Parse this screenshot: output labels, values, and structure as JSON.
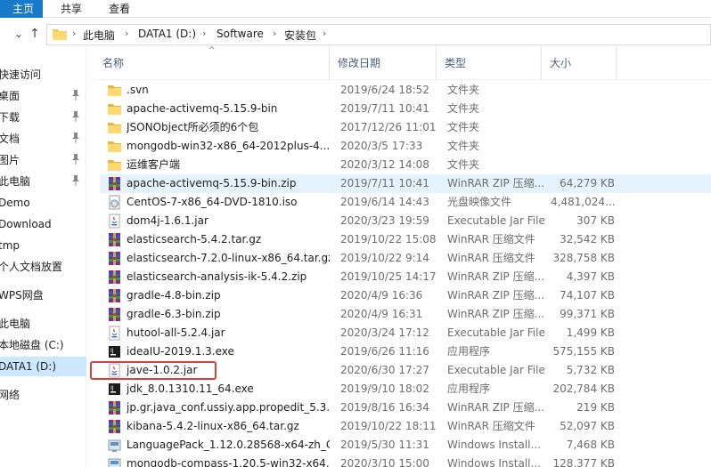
{
  "ribbon": {
    "tabs": [
      {
        "label": "主页"
      },
      {
        "label": "共享"
      },
      {
        "label": "查看"
      }
    ]
  },
  "address": {
    "crumbs": [
      "此电脑",
      "DATA1 (D:)",
      "Software",
      "安装包"
    ]
  },
  "nav": {
    "items": [
      {
        "label": "快速访问",
        "pinned": false
      },
      {
        "label": "桌面",
        "pinned": true
      },
      {
        "label": "下载",
        "pinned": true
      },
      {
        "label": "文档",
        "pinned": true
      },
      {
        "label": "图片",
        "pinned": true
      },
      {
        "label": "此电脑",
        "pinned": true
      },
      {
        "label": "Demo",
        "pinned": false
      },
      {
        "label": "Download",
        "pinned": false
      },
      {
        "label": "tmp",
        "pinned": false
      },
      {
        "label": "个人文档放置",
        "pinned": false
      },
      {
        "label": "WPS网盘",
        "pinned": false
      },
      {
        "label": "此电脑",
        "pinned": false
      },
      {
        "label": "本地磁盘 (C:)",
        "pinned": false
      },
      {
        "label": "DATA1 (D:)",
        "pinned": false,
        "selected": true
      },
      {
        "label": "网络",
        "pinned": false
      }
    ]
  },
  "columns": {
    "name": "名称",
    "date": "修改日期",
    "type": "类型",
    "size": "大小"
  },
  "files": [
    {
      "name": ".svn",
      "date": "2019/6/24 18:52",
      "type": "文件夹",
      "size": "",
      "icon": "folder-icon"
    },
    {
      "name": "apache-activemq-5.15.9-bin",
      "date": "2019/7/11 10:41",
      "type": "文件夹",
      "size": "",
      "icon": "folder-icon"
    },
    {
      "name": "JSONObject所必须的6个包",
      "date": "2017/12/26 11:01",
      "type": "文件夹",
      "size": "",
      "icon": "folder-icon"
    },
    {
      "name": "mongodb-win32-x86_64-2012plus-4....",
      "date": "2020/3/5 17:33",
      "type": "文件夹",
      "size": "",
      "icon": "folder-icon"
    },
    {
      "name": "运维客户端",
      "date": "2020/3/12 14:08",
      "type": "文件夹",
      "size": "",
      "icon": "folder-icon"
    },
    {
      "name": "apache-activemq-5.15.9-bin.zip",
      "date": "2019/7/11 10:41",
      "type": "WinRAR ZIP 压缩...",
      "size": "64,279 KB",
      "icon": "winrar-icon",
      "hover": true
    },
    {
      "name": "CentOS-7-x86_64-DVD-1810.iso",
      "date": "2019/6/14 14:43",
      "type": "光盘映像文件",
      "size": "4,481,024...",
      "icon": "disc-image-icon"
    },
    {
      "name": "dom4j-1.6.1.jar",
      "date": "2020/3/23 19:59",
      "type": "Executable Jar File",
      "size": "307 KB",
      "icon": "jar-icon"
    },
    {
      "name": "elasticsearch-5.4.2.tar.gz",
      "date": "2019/10/22 15:08",
      "type": "WinRAR 压缩文件",
      "size": "32,542 KB",
      "icon": "winrar-icon"
    },
    {
      "name": "elasticsearch-7.2.0-linux-x86_64.tar.gz",
      "date": "2019/10/22 9:14",
      "type": "WinRAR 压缩文件",
      "size": "328,758 KB",
      "icon": "winrar-icon"
    },
    {
      "name": "elasticsearch-analysis-ik-5.4.2.zip",
      "date": "2019/10/25 14:17",
      "type": "WinRAR ZIP 压缩...",
      "size": "4,397 KB",
      "icon": "winrar-icon"
    },
    {
      "name": "gradle-4.8-bin.zip",
      "date": "2020/4/9 16:36",
      "type": "WinRAR ZIP 压缩...",
      "size": "74,107 KB",
      "icon": "winrar-icon"
    },
    {
      "name": "gradle-6.3-bin.zip",
      "date": "2020/4/9 16:31",
      "type": "WinRAR ZIP 压缩...",
      "size": "99,371 KB",
      "icon": "winrar-icon"
    },
    {
      "name": "hutool-all-5.2.4.jar",
      "date": "2020/3/24 17:12",
      "type": "Executable Jar File",
      "size": "1,499 KB",
      "icon": "jar-icon"
    },
    {
      "name": "ideaIU-2019.1.3.exe",
      "date": "2019/6/26 11:16",
      "type": "应用程序",
      "size": "575,155 KB",
      "icon": "exe-icon"
    },
    {
      "name": "jave-1.0.2.jar",
      "date": "2020/6/30 17:27",
      "type": "Executable Jar File",
      "size": "5,732 KB",
      "icon": "jar-icon"
    },
    {
      "name": "jdk_8.0.1310.11_64.exe",
      "date": "2019/9/10 18:02",
      "type": "应用程序",
      "size": "202,784 KB",
      "icon": "exe-icon"
    },
    {
      "name": "jp.gr.java_conf.ussiy.app.propedit_5.3...",
      "date": "2019/8/16 16:34",
      "type": "WinRAR ZIP 压缩...",
      "size": "219 KB",
      "icon": "winrar-icon"
    },
    {
      "name": "kibana-5.4.2-linux-x86_64.tar.gz",
      "date": "2019/10/22 18:11",
      "type": "WinRAR 压缩文件",
      "size": "52,097 KB",
      "icon": "winrar-icon"
    },
    {
      "name": "LanguagePack_1.12.0.28568-x64-zh_C...",
      "date": "2019/5/30 11:31",
      "type": "Windows Install...",
      "size": "7,468 KB",
      "icon": "installer-icon"
    },
    {
      "name": "mongodb-compass-1.20.5-win32-x64...",
      "date": "2020/3/10 15:00",
      "type": "Windows Install...",
      "size": "128,377 KB",
      "icon": "installer-icon"
    }
  ],
  "colors": {
    "accent": "#1979ca",
    "selected_nav": "#cce8ff",
    "hover_row": "#e5f3ff",
    "highlight_box": "#e23b3b",
    "folder": "#f5c94c"
  }
}
